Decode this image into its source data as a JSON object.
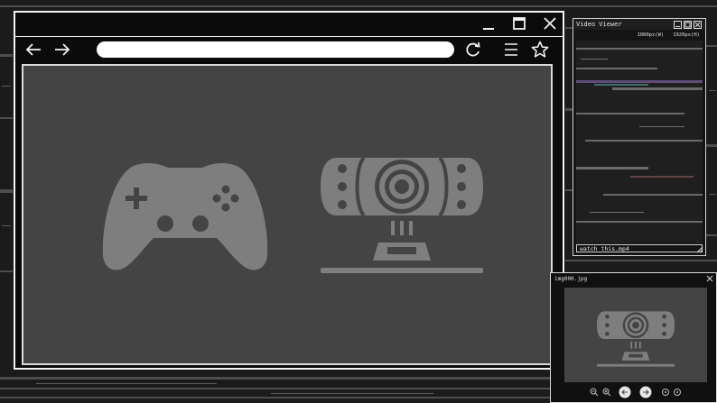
{
  "browser": {
    "nav": {
      "back": "arrow-left",
      "forward": "arrow-right",
      "refresh": "refresh",
      "menu": "hamburger",
      "bookmark": "star"
    },
    "window_controls": [
      "minimize",
      "maximize",
      "close"
    ],
    "content_icons": [
      "gamepad-icon",
      "webcam-icon"
    ]
  },
  "video_viewer": {
    "title": "Video Viewer",
    "res_height": "1080px(W)",
    "res_width": "1920px(H)",
    "filename": "watch_this.mp4"
  },
  "image_viewer": {
    "title": "img000.jpg"
  },
  "colors": {
    "content_bg": "#444444",
    "icon_gray": "#7e7e7e",
    "frame": "#f2f2f2"
  }
}
